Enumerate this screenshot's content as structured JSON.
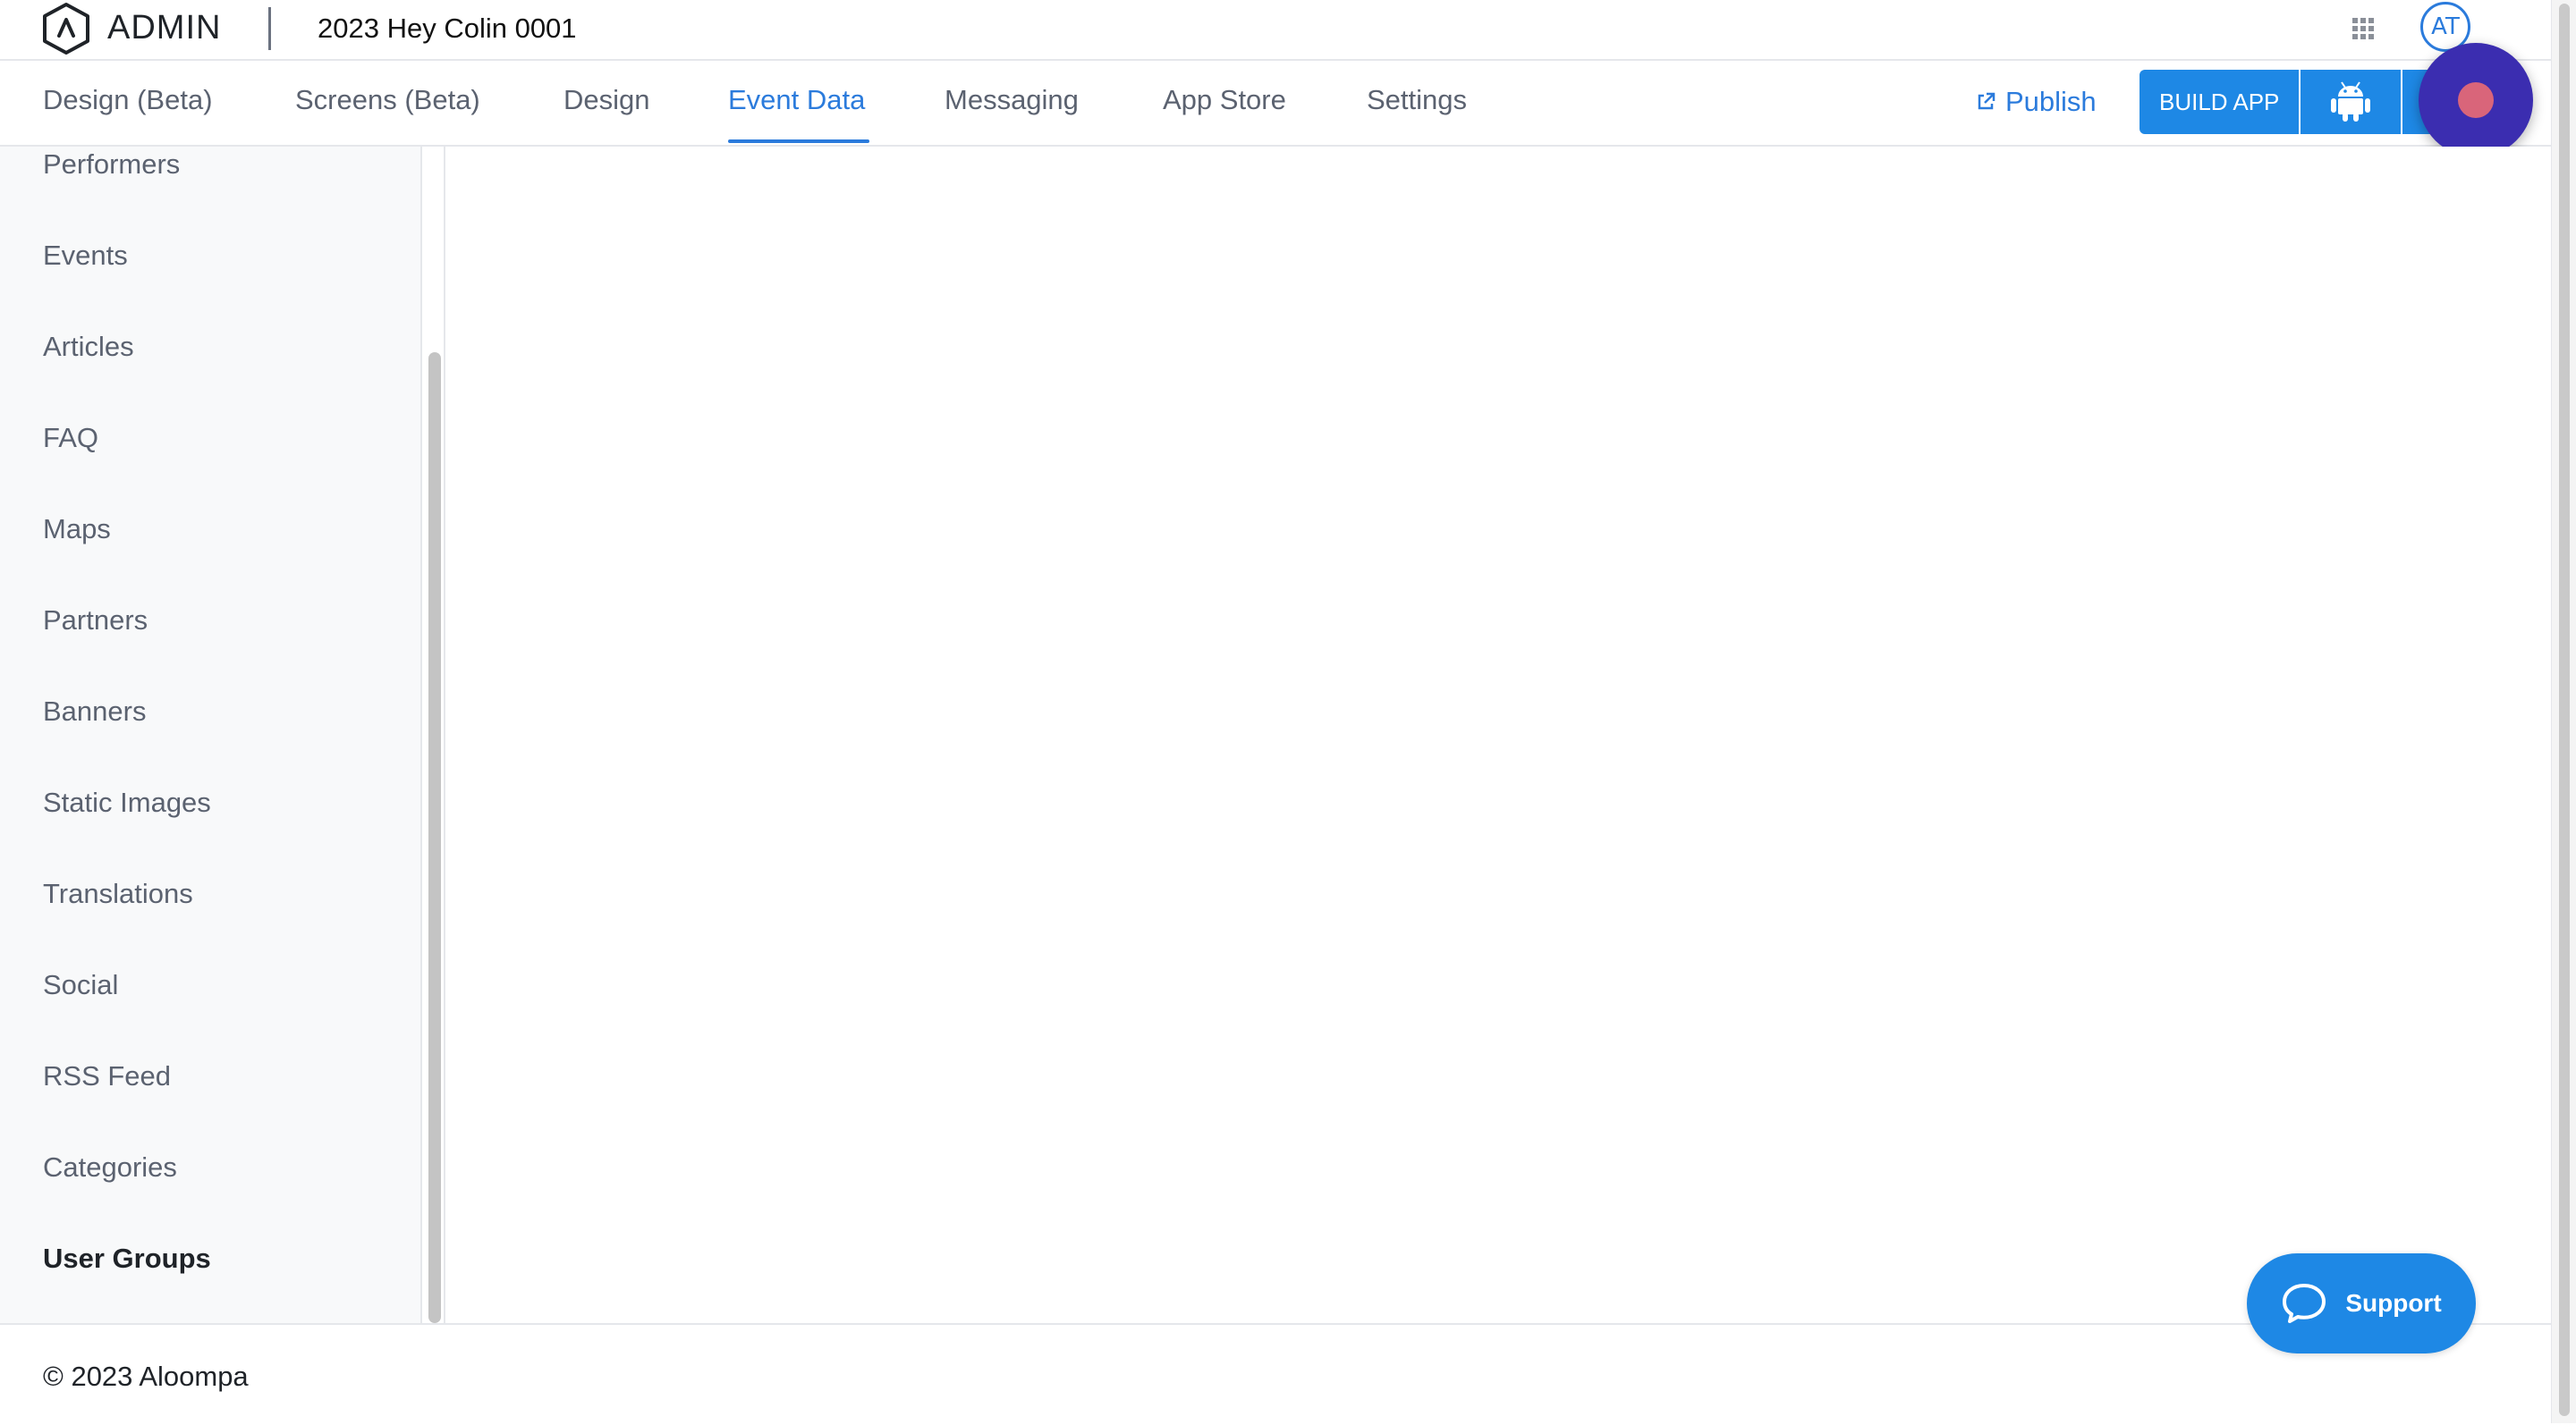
{
  "header": {
    "brand": "ADMIN",
    "project_title": "2023 Hey Colin 0001",
    "avatar_initials": "AT",
    "icons": {
      "logo": "hex-logo-icon",
      "apps": "apps-grid-icon"
    }
  },
  "nav": {
    "tabs": [
      {
        "label": "Design (Beta)",
        "active": false
      },
      {
        "label": "Screens (Beta)",
        "active": false
      },
      {
        "label": "Design",
        "active": false
      },
      {
        "label": "Event Data",
        "active": true
      },
      {
        "label": "Messaging",
        "active": false
      },
      {
        "label": "App Store",
        "active": false
      },
      {
        "label": "Settings",
        "active": false
      }
    ],
    "publish_label": "Publish",
    "build_label": "BUILD APP",
    "icons": {
      "publish": "external-link-icon",
      "android": "android-icon",
      "record": "record-icon"
    }
  },
  "sidebar": {
    "items": [
      {
        "label": "Performers",
        "active": false
      },
      {
        "label": "Events",
        "active": false
      },
      {
        "label": "Articles",
        "active": false
      },
      {
        "label": "FAQ",
        "active": false
      },
      {
        "label": "Maps",
        "active": false
      },
      {
        "label": "Partners",
        "active": false
      },
      {
        "label": "Banners",
        "active": false
      },
      {
        "label": "Static Images",
        "active": false
      },
      {
        "label": "Translations",
        "active": false
      },
      {
        "label": "Social",
        "active": false
      },
      {
        "label": "RSS Feed",
        "active": false
      },
      {
        "label": "Categories",
        "active": false
      },
      {
        "label": "User Groups",
        "active": true
      }
    ]
  },
  "footer": {
    "copyright": "© 2023 Aloompa"
  },
  "support": {
    "label": "Support",
    "icon": "chat-bubble-icon"
  },
  "colors": {
    "accent": "#2b7bdc",
    "button": "#1e88e5",
    "record_bg": "#3b2db0",
    "record_dot": "#d9657a"
  }
}
